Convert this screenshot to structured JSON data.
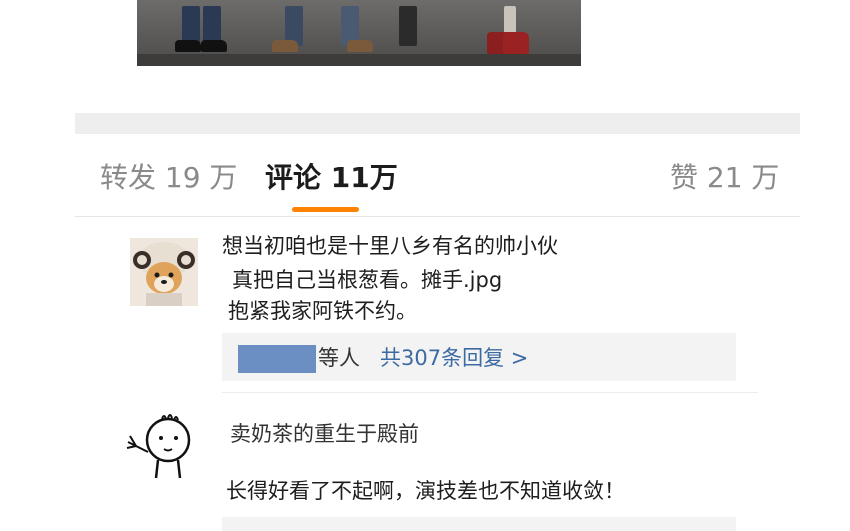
{
  "tabs": {
    "repost": "转发 19 万",
    "comment": "评论 11万",
    "like": "赞 21 万",
    "active_color": "#ff8200"
  },
  "comments": [
    {
      "username": "想当初咱也是十里八乡有名的帅小伙",
      "avatar": "dog-avatar",
      "lines": [
        "真把自己当根葱看。摊手.jpg",
        "抱紧我家阿铁不约。"
      ],
      "reply": {
        "people_label": "等人",
        "count_label": "共307条回复 >"
      }
    },
    {
      "username": "卖奶茶的重生于殿前",
      "avatar": "doodle-avatar",
      "lines": [
        "长得好看了不起啊，演技差也不知道收敛！"
      ]
    }
  ],
  "colors": {
    "link": "#3c6aa3",
    "redacted_block": "#6b8fc2"
  }
}
